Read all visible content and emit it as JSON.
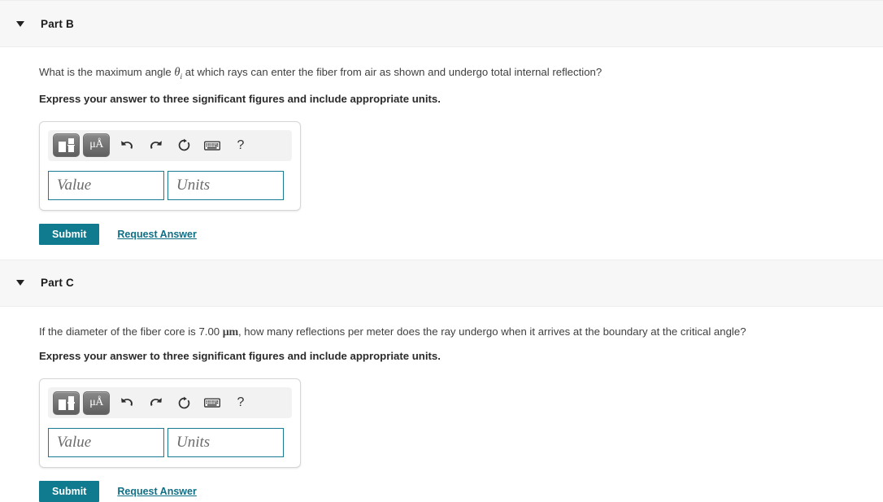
{
  "parts": [
    {
      "id": "part-b",
      "caret_icon": "triangle-down-icon",
      "title": "Part B",
      "question_prefix": "What is the maximum angle ",
      "question_math_symbol": "θ",
      "question_math_sub": "i",
      "question_suffix": " at which rays can enter the fiber from air as shown and undergo total internal reflection?",
      "instruction": "Express your answer to three significant figures and include appropriate units.",
      "toolbar": {
        "template_label": "math-template",
        "units_label": "μÅ",
        "undo_label": "undo",
        "redo_label": "redo",
        "reset_label": "reset",
        "keyboard_label": "keyboard",
        "help_label": "?"
      },
      "value_placeholder": "Value",
      "units_placeholder": "Units",
      "submit_label": "Submit",
      "request_label": "Request Answer"
    },
    {
      "id": "part-c",
      "caret_icon": "triangle-down-icon",
      "title": "Part C",
      "question_prefix": "If the diameter of the fiber core is 7.00 ",
      "question_math_symbol": "μm",
      "question_math_sub": "",
      "question_suffix": ", how many reflections per meter does the ray undergo when it arrives at the boundary at the critical angle?",
      "instruction": "Express your answer to three significant figures and include appropriate units.",
      "toolbar": {
        "template_label": "math-template",
        "units_label": "μÅ",
        "undo_label": "undo",
        "redo_label": "redo",
        "reset_label": "reset",
        "keyboard_label": "keyboard",
        "help_label": "?"
      },
      "value_placeholder": "Value",
      "units_placeholder": "Units",
      "submit_label": "Submit",
      "request_label": "Request Answer"
    }
  ],
  "colors": {
    "accent": "#107a8f",
    "link": "#0f6f86",
    "header_bg": "#f7f7f7",
    "field_border": "#1d7a95"
  }
}
